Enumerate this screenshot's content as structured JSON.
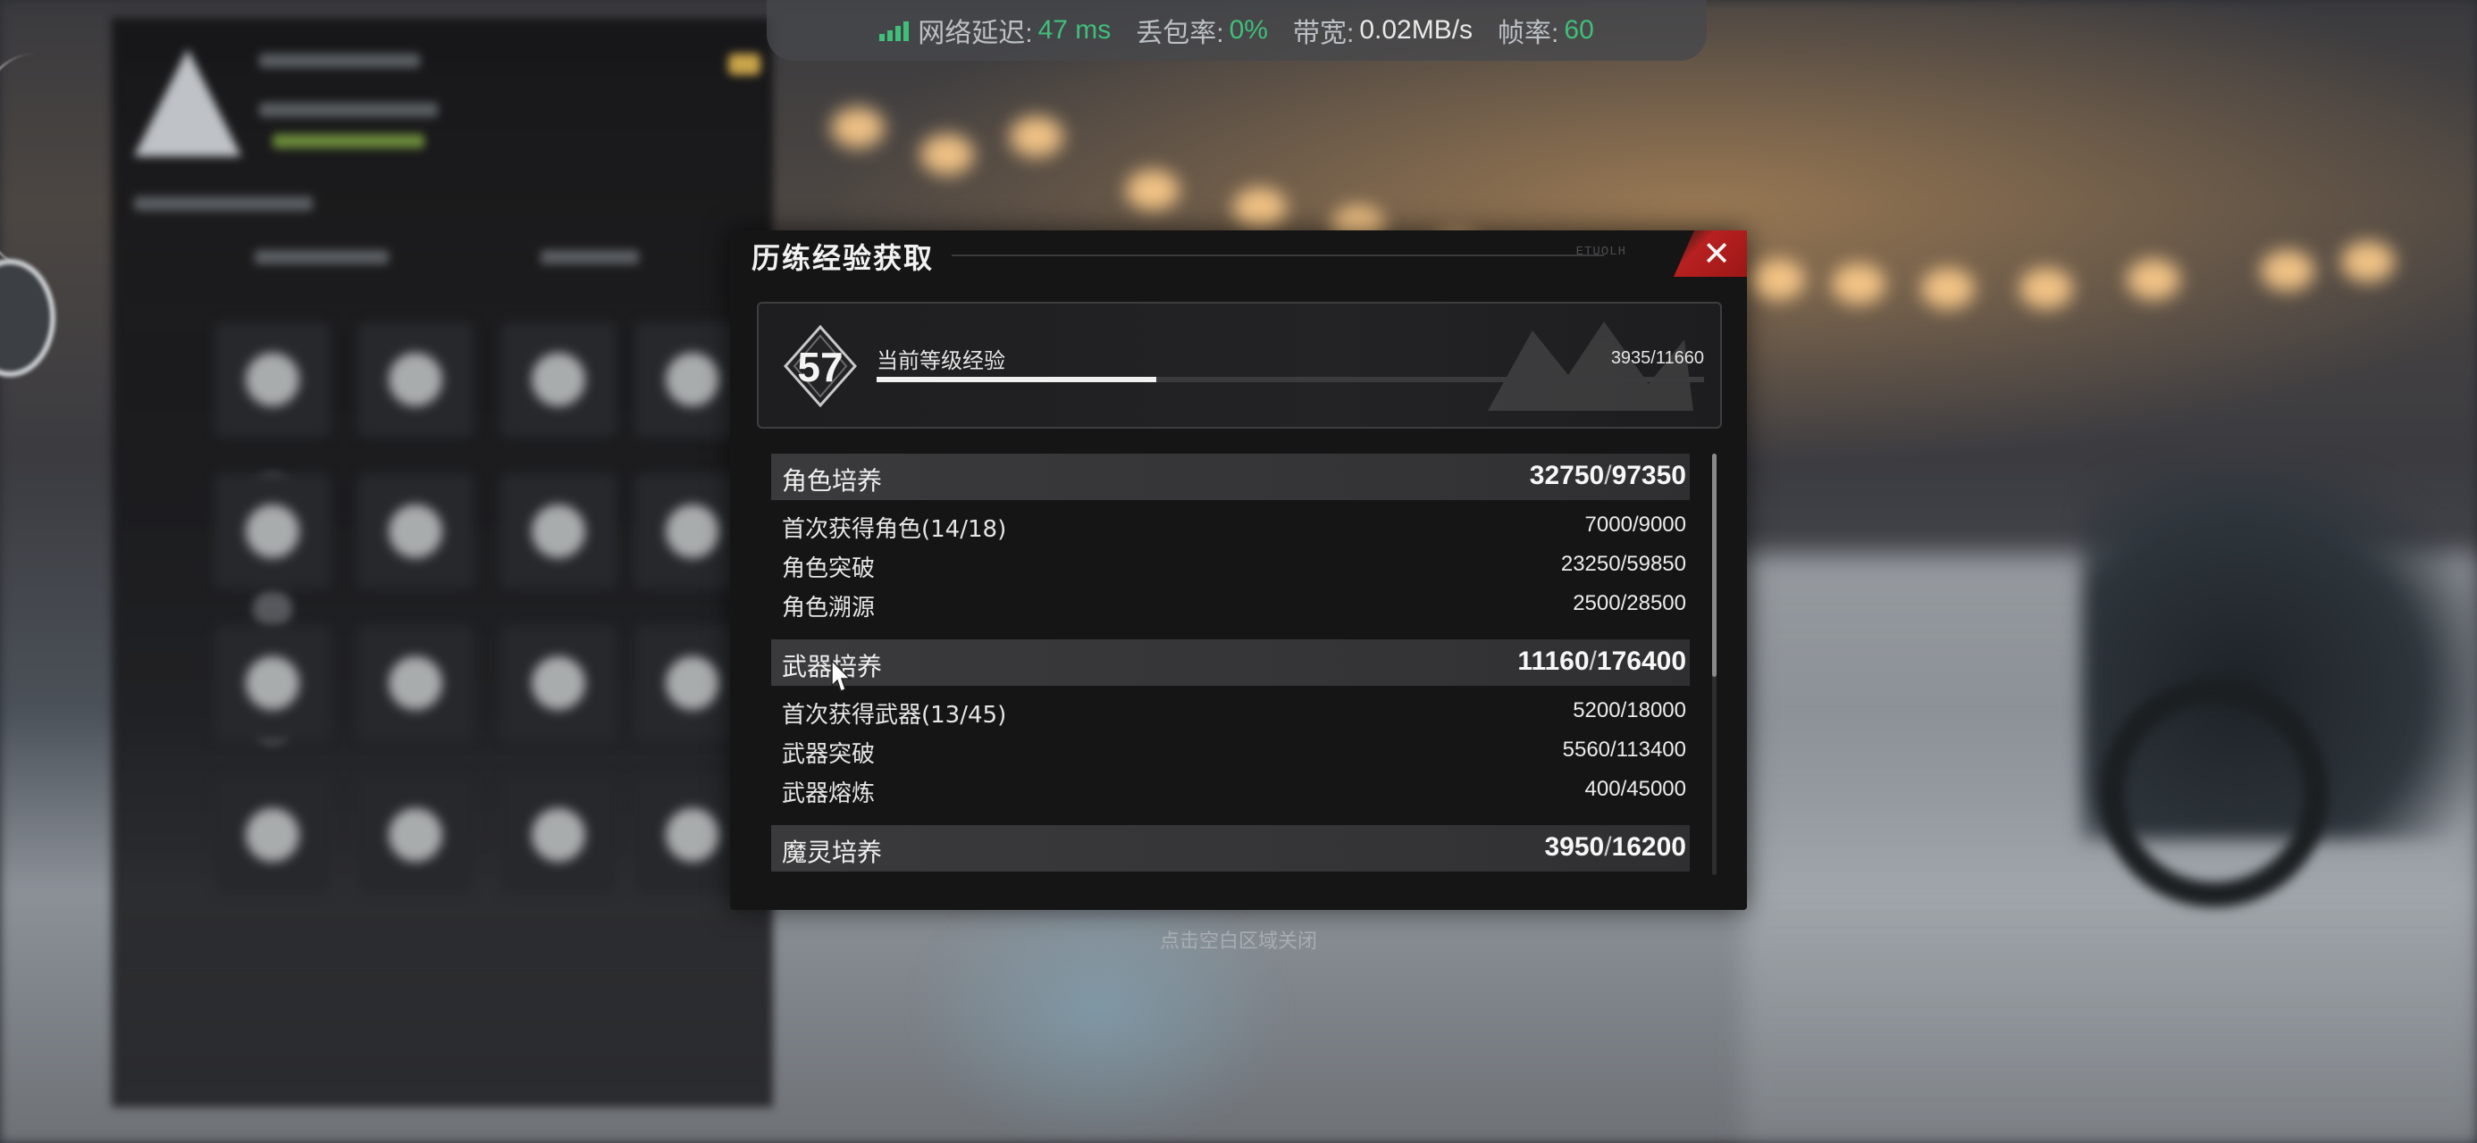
{
  "network": {
    "latency_label": "网络延迟:",
    "latency_value": "47 ms",
    "loss_label": "丢包率:",
    "loss_value": "0%",
    "bandwidth_label": "带宽:",
    "bandwidth_value": "0.02MB/s",
    "fps_label": "帧率:",
    "fps_value": "60",
    "icon": "signal-bars-icon",
    "accent_color": "#3fbf7a"
  },
  "dialog": {
    "title": "历练经验获取",
    "close_icon": "close-icon",
    "header_deco": "ETUOLH"
  },
  "level": {
    "number": "57",
    "label": "当前等级经验",
    "exp": "3935/11660",
    "progress_fraction": 0.3375
  },
  "groups": [
    {
      "name": "角色培养",
      "current": "32750",
      "total": "97350",
      "items": [
        {
          "name": "首次获得角色(14/18)",
          "value": "7000/9000"
        },
        {
          "name": "角色突破",
          "value": "23250/59850"
        },
        {
          "name": "角色溯源",
          "value": "2500/28500"
        }
      ]
    },
    {
      "name": "武器培养",
      "current": "11160",
      "total": "176400",
      "items": [
        {
          "name": "首次获得武器(13/45)",
          "value": "5200/18000"
        },
        {
          "name": "武器突破",
          "value": "5560/113400"
        },
        {
          "name": "武器熔炼",
          "value": "400/45000"
        }
      ]
    },
    {
      "name": "魔灵培养",
      "current": "3950",
      "total": "16200",
      "items": []
    }
  ],
  "close_hint": "点击空白区域关闭",
  "colors": {
    "dialog_bg": "#151516",
    "close_red": "#b82020",
    "category_bg": "#3a3a3c"
  }
}
